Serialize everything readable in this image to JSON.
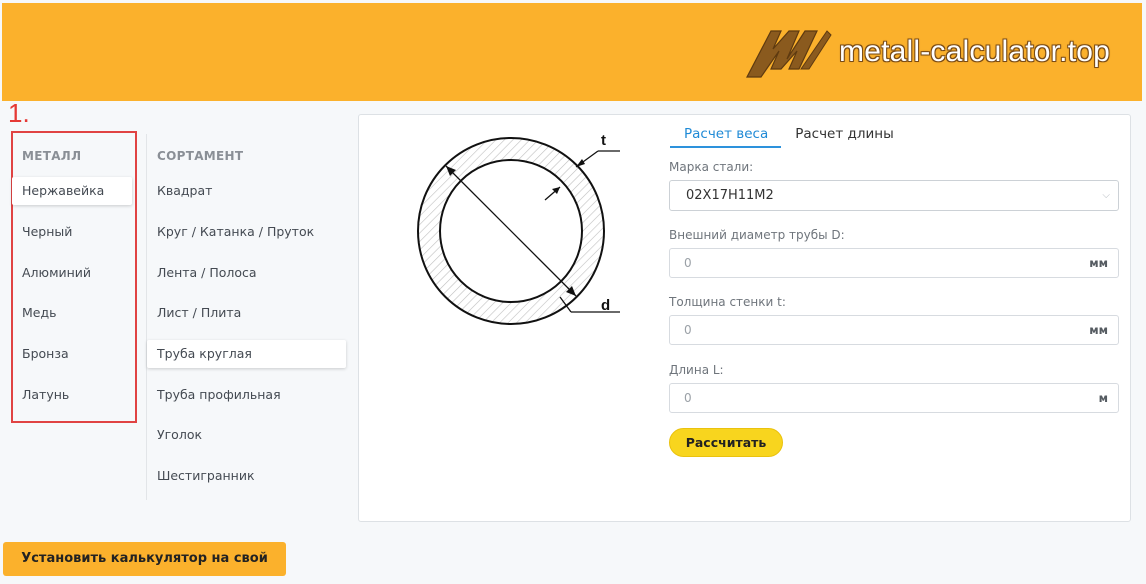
{
  "header": {
    "brand_color": "#fbb12c",
    "logo_text": "metall-calculator.top"
  },
  "annotation": {
    "step_number": "1.",
    "highlight_color": "#e04343"
  },
  "metal": {
    "title": "МЕТАЛЛ",
    "items": [
      {
        "label": "Нержавейка",
        "active": true
      },
      {
        "label": "Черный",
        "active": false
      },
      {
        "label": "Алюминий",
        "active": false
      },
      {
        "label": "Медь",
        "active": false
      },
      {
        "label": "Бронза",
        "active": false
      },
      {
        "label": "Латунь",
        "active": false
      }
    ]
  },
  "assortment": {
    "title": "СОРТАМЕНТ",
    "items": [
      {
        "label": "Квадрат",
        "active": false
      },
      {
        "label": "Круг / Катанка / Пруток",
        "active": false
      },
      {
        "label": "Лента / Полоса",
        "active": false
      },
      {
        "label": "Лист / Плита",
        "active": false
      },
      {
        "label": "Труба круглая",
        "active": true
      },
      {
        "label": "Труба профильная",
        "active": false
      },
      {
        "label": "Уголок",
        "active": false
      },
      {
        "label": "Шестигранник",
        "active": false
      }
    ]
  },
  "diagram": {
    "label_t": "t",
    "label_d": "d"
  },
  "tabs": [
    {
      "label": "Расчет веса",
      "active": true
    },
    {
      "label": "Расчет длины",
      "active": false
    }
  ],
  "form": {
    "steel_grade": {
      "label": "Марка стали:",
      "value": "02Х17Н11М2"
    },
    "outer_diameter": {
      "label": "Внешний диаметр трубы D:",
      "value": "0",
      "unit": "мм"
    },
    "wall_thickness": {
      "label": "Толщина стенки t:",
      "value": "0",
      "unit": "мм"
    },
    "length": {
      "label": "Длина L:",
      "value": "0",
      "unit": "м"
    },
    "calculate_label": "Рассчитать"
  },
  "install_button_label": "Установить калькулятор на свой сайт"
}
